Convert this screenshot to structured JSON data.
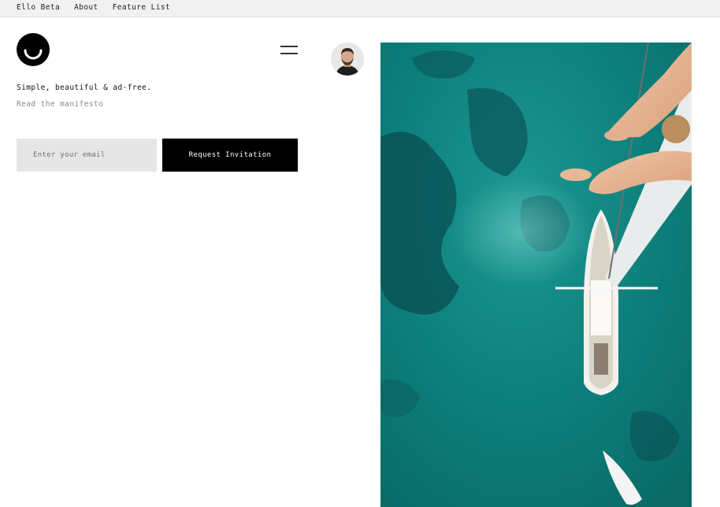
{
  "topnav": {
    "items": [
      {
        "label": "Ello Beta"
      },
      {
        "label": "About"
      },
      {
        "label": "Feature List"
      }
    ]
  },
  "hero": {
    "tagline": "Simple, beautiful & ad-free.",
    "manifesto_link": "Read the manifesto"
  },
  "signup": {
    "email_placeholder": "Enter your email",
    "email_value": "",
    "submit_label": "Request Invitation"
  },
  "colors": {
    "button_bg": "#000000",
    "input_bg": "#e6e6e6",
    "water": "#0b7c78"
  },
  "icons": {
    "logo": "ello-smile-logo",
    "menu": "hamburger-menu-icon"
  }
}
